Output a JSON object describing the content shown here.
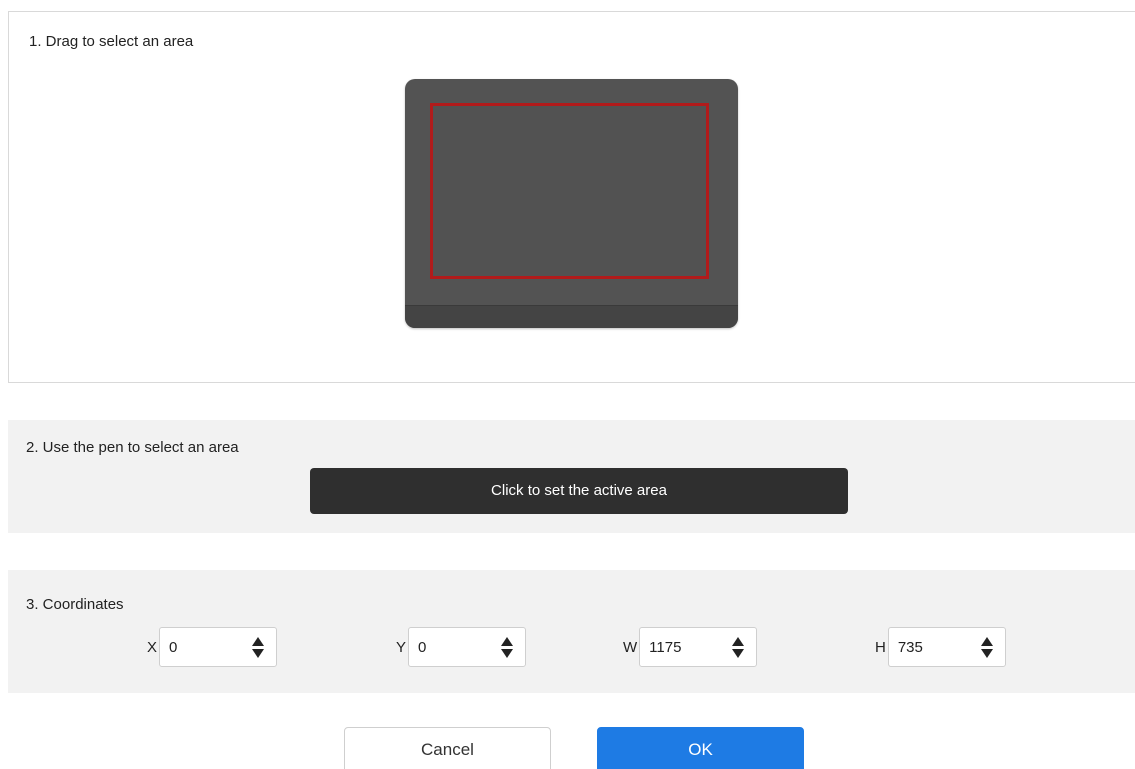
{
  "section1": {
    "title": "1. Drag to select an area"
  },
  "section2": {
    "title": "2. Use the pen to select an area",
    "button_label": "Click to set the active area"
  },
  "section3": {
    "title": "3. Coordinates",
    "fields": [
      {
        "label": "X",
        "value": "0"
      },
      {
        "label": "Y",
        "value": "0"
      },
      {
        "label": "W",
        "value": "1175"
      },
      {
        "label": "H",
        "value": "735"
      }
    ]
  },
  "buttons": {
    "cancel_label": "Cancel",
    "ok_label": "OK"
  },
  "colors": {
    "accent": "#1e7be4",
    "selection_border": "#b11b1b",
    "tablet": "#535353",
    "dark_button": "#2f2f2f"
  }
}
